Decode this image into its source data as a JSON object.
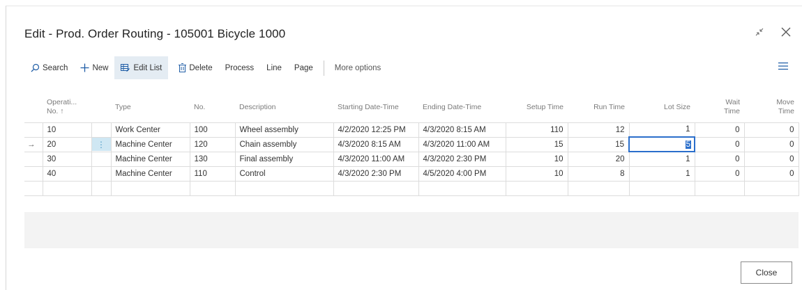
{
  "title": "Edit - Prod. Order Routing - 105001 Bicycle 1000",
  "actions": {
    "search": "Search",
    "new": "New",
    "edit_list": "Edit List",
    "delete": "Delete",
    "process": "Process",
    "line": "Line",
    "page": "Page",
    "more_options": "More options"
  },
  "columns": {
    "op_no_1": "Operati...",
    "op_no_2": "No. ↑",
    "type": "Type",
    "no": "No.",
    "description": "Description",
    "start": "Starting Date-Time",
    "end": "Ending Date-Time",
    "setup": "Setup Time",
    "run": "Run Time",
    "lot": "Lot Size",
    "wait_1": "Wait",
    "wait_2": "Time",
    "move_1": "Move",
    "move_2": "Time"
  },
  "rows": [
    {
      "op": "10",
      "type": "Work Center",
      "no": "100",
      "desc": "Wheel assembly",
      "start": "4/2/2020 12:25 PM",
      "end": "4/3/2020 8:15 AM",
      "setup": "110",
      "run": "12",
      "lot": "1",
      "wait": "0",
      "move": "0"
    },
    {
      "op": "20",
      "type": "Machine Center",
      "no": "120",
      "desc": "Chain assembly",
      "start": "4/3/2020 8:15 AM",
      "end": "4/3/2020 11:00 AM",
      "setup": "15",
      "run": "15",
      "lot": "5",
      "wait": "0",
      "move": "0"
    },
    {
      "op": "30",
      "type": "Machine Center",
      "no": "130",
      "desc": "Final assembly",
      "start": "4/3/2020 11:00 AM",
      "end": "4/3/2020 2:30 PM",
      "setup": "10",
      "run": "20",
      "lot": "1",
      "wait": "0",
      "move": "0"
    },
    {
      "op": "40",
      "type": "Machine Center",
      "no": "110",
      "desc": "Control",
      "start": "4/3/2020 2:30 PM",
      "end": "4/5/2020 4:00 PM",
      "setup": "10",
      "run": "8",
      "lot": "1",
      "wait": "0",
      "move": "0"
    }
  ],
  "current_row_marker": "→",
  "close_label": "Close"
}
